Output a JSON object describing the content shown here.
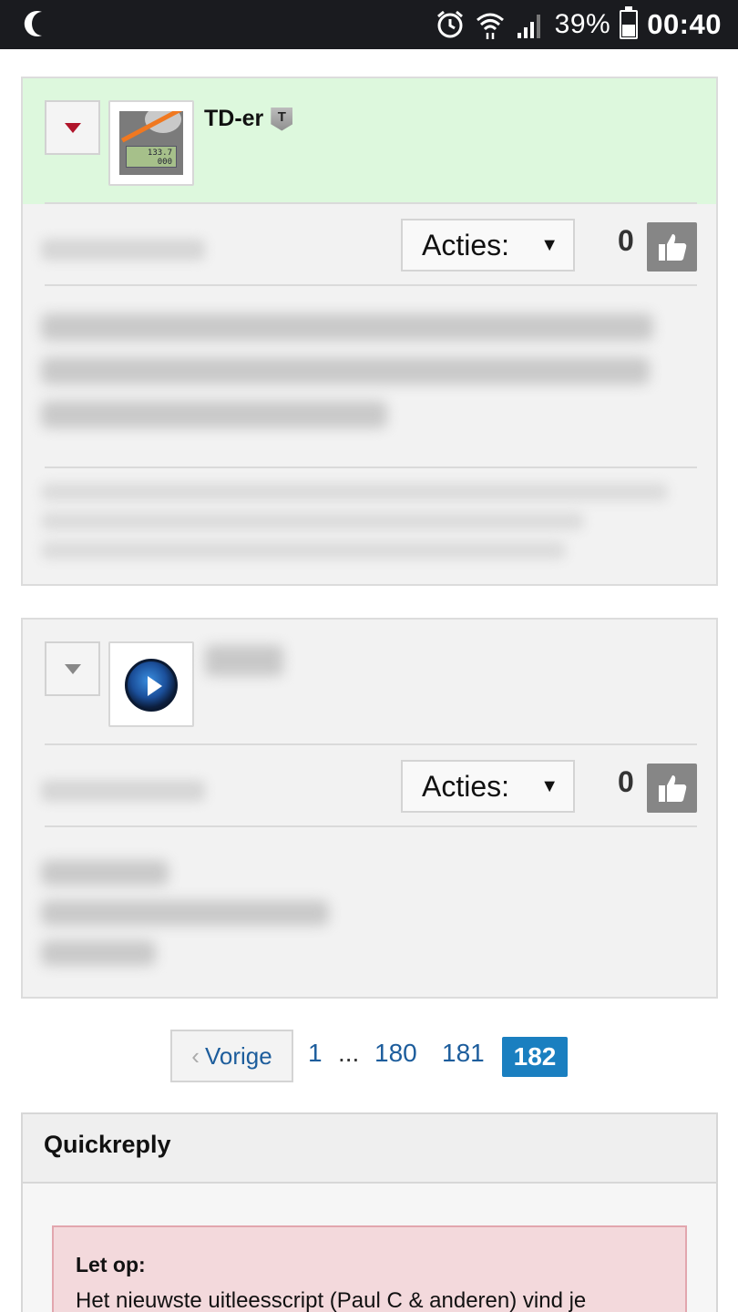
{
  "status_bar": {
    "battery_percent": "39%",
    "time": "00:40",
    "icons": [
      "moon-icon",
      "alarm-icon",
      "wifi-icon",
      "signal-icon",
      "battery-icon"
    ]
  },
  "posts": [
    {
      "username": "TD-er",
      "badge": "T",
      "avatar_display": "133.7\n000",
      "actions_label": "Acties:",
      "likes": "0",
      "header_color": "#ddf8dd"
    },
    {
      "username": "",
      "actions_label": "Acties:",
      "likes": "0"
    }
  ],
  "pagination": {
    "prev_label": "Vorige",
    "pages": [
      "1",
      "180",
      "181"
    ],
    "ellipsis": "...",
    "current": "182"
  },
  "quickreply": {
    "title": "Quickreply",
    "alert_title": "Let op:",
    "alert_text": "Het nieuwste uitleesscript (Paul C & anderen) vind je"
  },
  "colors": {
    "accent": "#1a7fc0",
    "link": "#1d5d9c",
    "alert_bg": "#f3d9dc"
  }
}
